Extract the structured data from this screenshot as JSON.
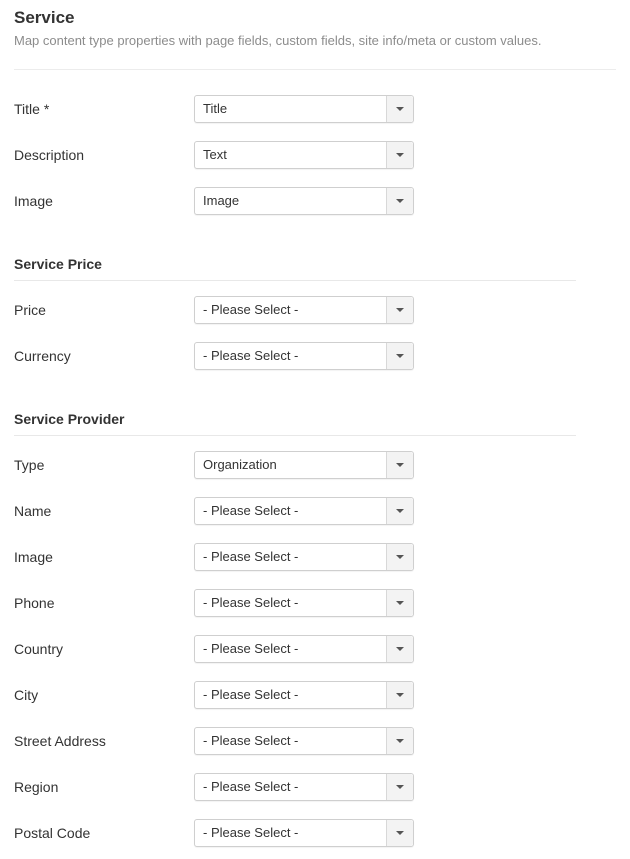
{
  "header": {
    "title": "Service",
    "subtitle": "Map content type properties with page fields, custom fields, site info/meta or custom values."
  },
  "main_fields": [
    {
      "label": "Title *",
      "value": "Title"
    },
    {
      "label": "Description",
      "value": "Text"
    },
    {
      "label": "Image",
      "value": "Image"
    }
  ],
  "sections": {
    "price": {
      "title": "Service Price",
      "fields": [
        {
          "label": "Price",
          "value": "- Please Select -"
        },
        {
          "label": "Currency",
          "value": "- Please Select -"
        }
      ]
    },
    "provider": {
      "title": "Service Provider",
      "fields": [
        {
          "label": "Type",
          "value": "Organization"
        },
        {
          "label": "Name",
          "value": "- Please Select -"
        },
        {
          "label": "Image",
          "value": "- Please Select -"
        },
        {
          "label": "Phone",
          "value": "- Please Select -"
        },
        {
          "label": "Country",
          "value": "- Please Select -"
        },
        {
          "label": "City",
          "value": "- Please Select -"
        },
        {
          "label": "Street Address",
          "value": "- Please Select -"
        },
        {
          "label": "Region",
          "value": "- Please Select -"
        },
        {
          "label": "Postal Code",
          "value": "- Please Select -"
        }
      ]
    }
  },
  "icons": {
    "dropdown": "caret-down-icon"
  }
}
